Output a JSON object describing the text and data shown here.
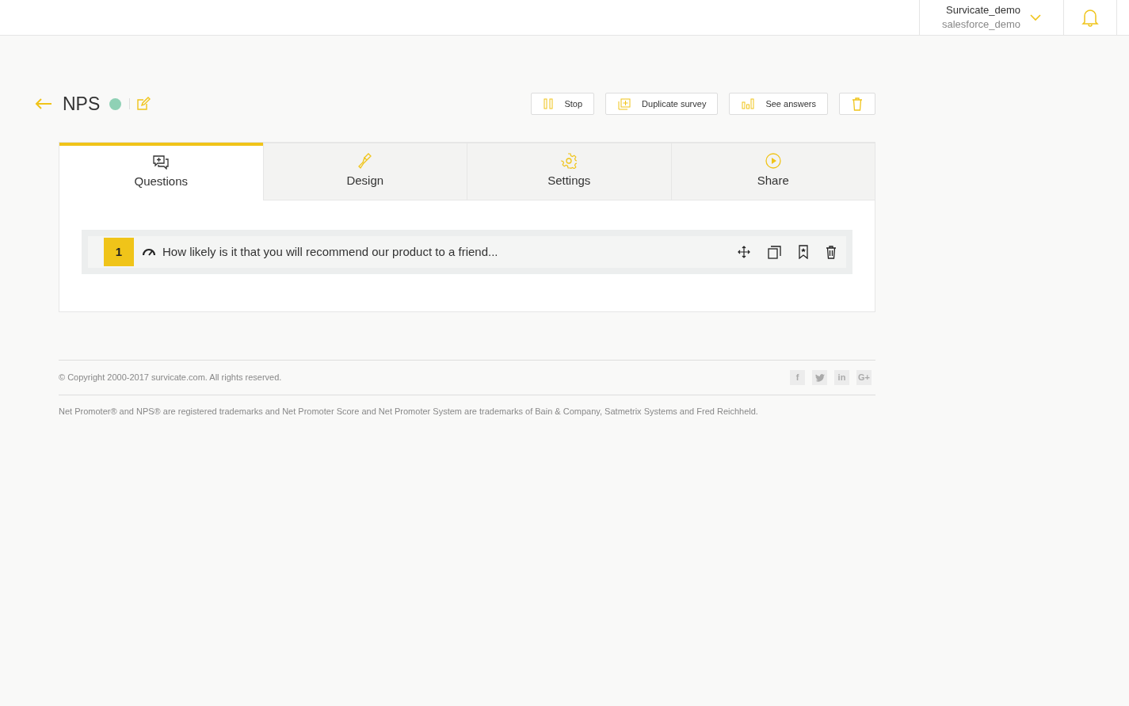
{
  "account": {
    "name": "Survicate_demo",
    "org": "salesforce_demo"
  },
  "survey": {
    "title": "NPS",
    "active": true
  },
  "actions": [
    {
      "kind": "stop",
      "label": "Stop"
    },
    {
      "kind": "duplicate",
      "label": "Duplicate survey"
    },
    {
      "kind": "answers",
      "label": "See answers"
    },
    {
      "kind": "delete"
    }
  ],
  "tabs": [
    {
      "kind": "questions",
      "label": "Questions",
      "selected": true
    },
    {
      "kind": "design",
      "label": "Design",
      "selected": false
    },
    {
      "kind": "settings",
      "label": "Settings",
      "selected": false
    },
    {
      "kind": "share",
      "label": "Share",
      "selected": false
    }
  ],
  "questions": [
    {
      "number": "1",
      "text": "How likely is it that you will recommend our product to a friend..."
    }
  ],
  "footer": {
    "copyright": "© Copyright 2000-2017 survicate.com. All rights reserved.",
    "social": [
      {
        "kind": "text",
        "label": "f"
      },
      {
        "kind": "twitter"
      },
      {
        "kind": "text",
        "label": "in"
      },
      {
        "kind": "text",
        "label": "G+"
      }
    ],
    "trademark": "Net Promoter® and NPS® are registered trademarks and Net Promoter Score and Net Promoter System are trademarks of Bain & Company, Satmetrix Systems and Fred Reichheld."
  }
}
